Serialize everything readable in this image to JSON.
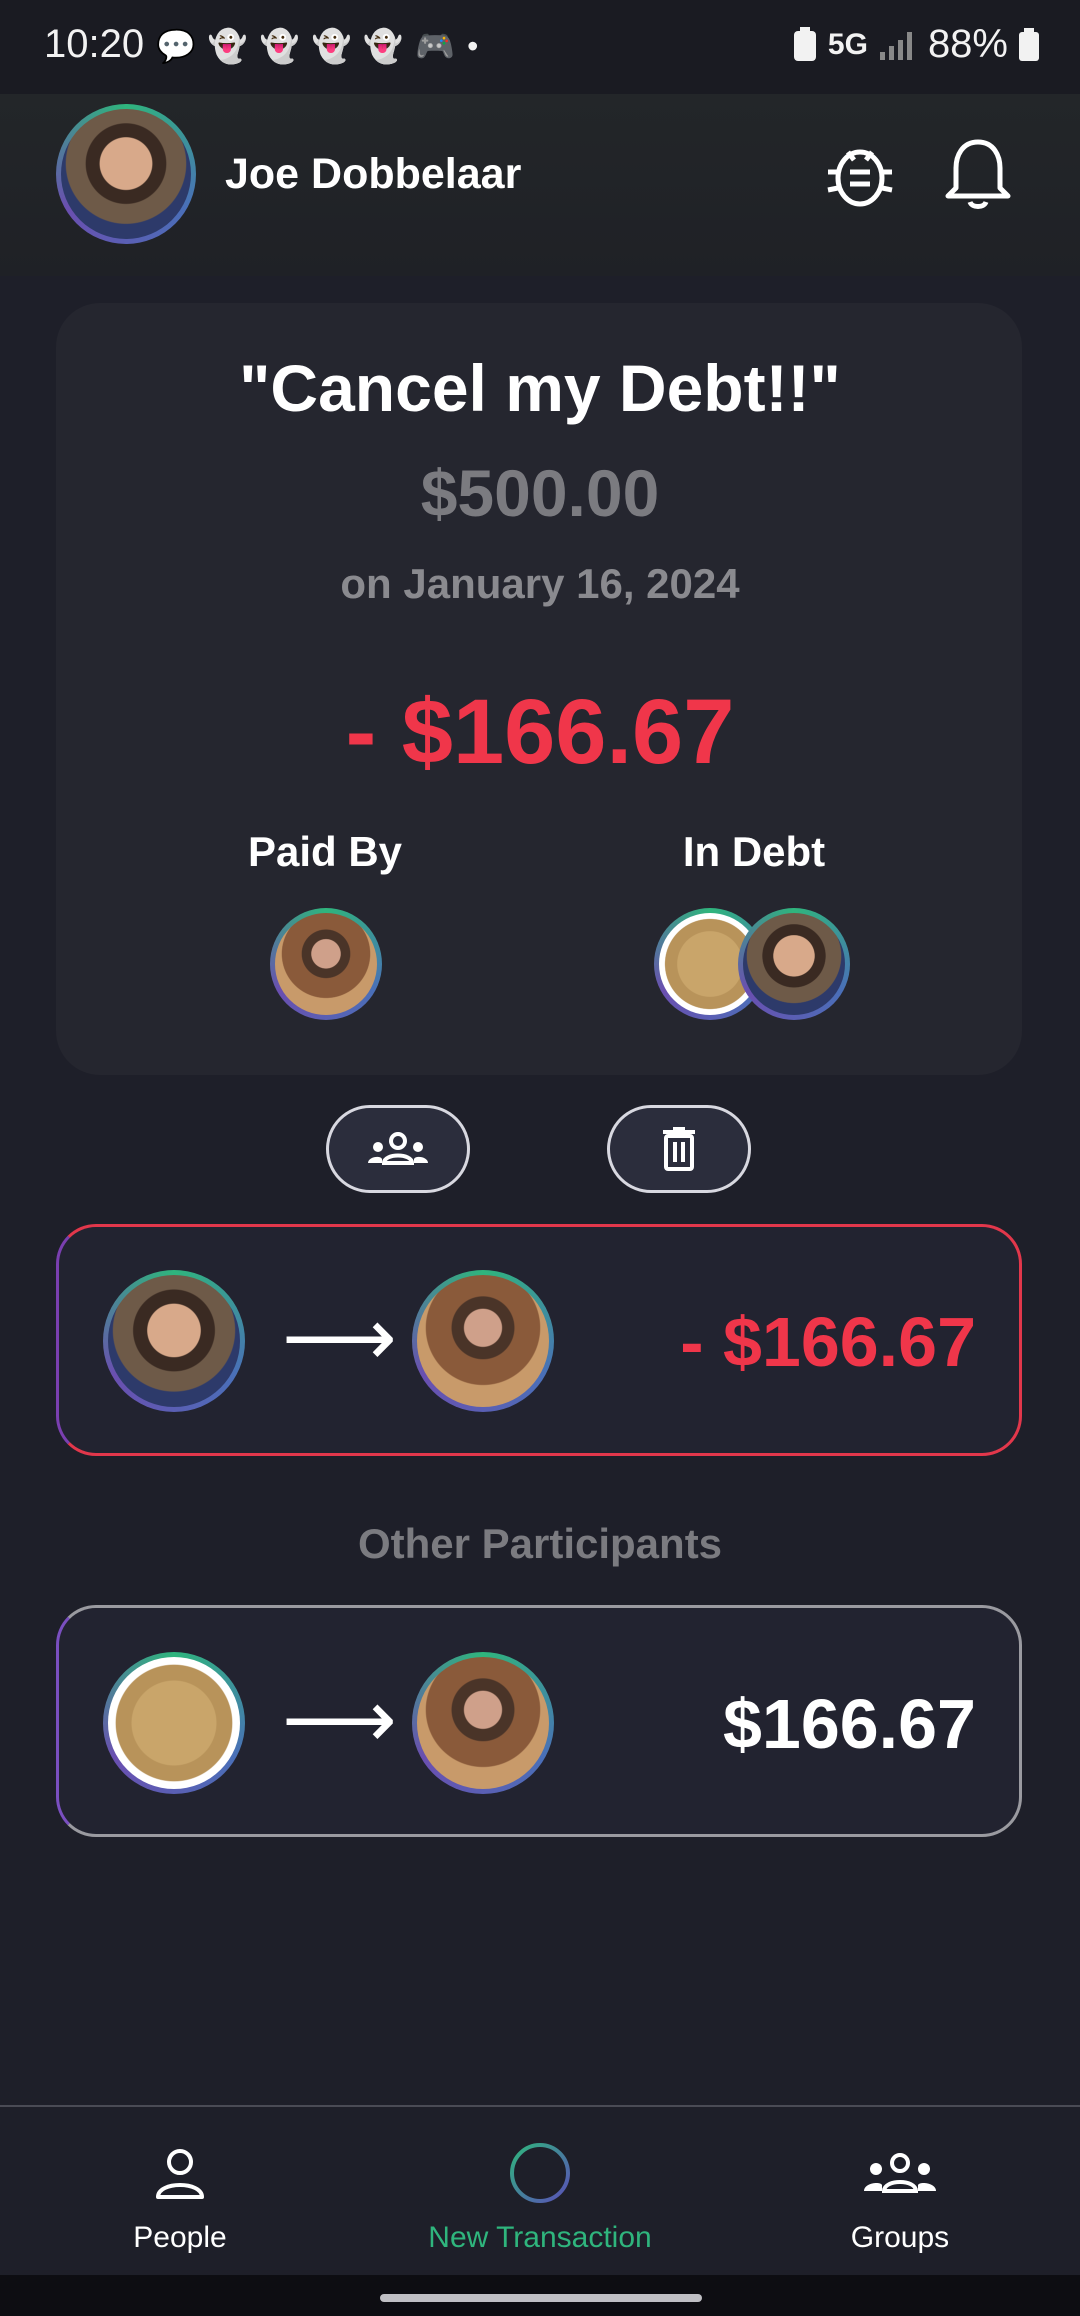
{
  "status_bar": {
    "time": "10:20",
    "network": "5G",
    "battery": "88%"
  },
  "header": {
    "user_name": "Joe Dobbelaar"
  },
  "transaction": {
    "title": "\"Cancel my Debt!!\"",
    "total_amount": "$500.00",
    "date": "on January 16, 2024",
    "your_share": "- $166.67",
    "paid_by_label": "Paid By",
    "in_debt_label": "In Debt"
  },
  "flows": {
    "own": {
      "amount": "- $166.67"
    },
    "other_section_title": "Other Participants",
    "other": {
      "amount": "$166.67"
    }
  },
  "nav": {
    "people": "People",
    "new_transaction": "New Transaction",
    "groups": "Groups"
  },
  "colors": {
    "background": "#1e1f29",
    "card": "#25262f",
    "negative": "#f0364a",
    "accent_green": "#2fb57d",
    "accent_purple": "#7a3fb0"
  },
  "icons": {
    "bug": "bug-icon",
    "bell": "bell-icon",
    "group": "people-group-icon",
    "trash": "trash-icon",
    "arrow": "arrow-right-icon",
    "person": "person-icon",
    "add": "plus-circle-icon"
  }
}
